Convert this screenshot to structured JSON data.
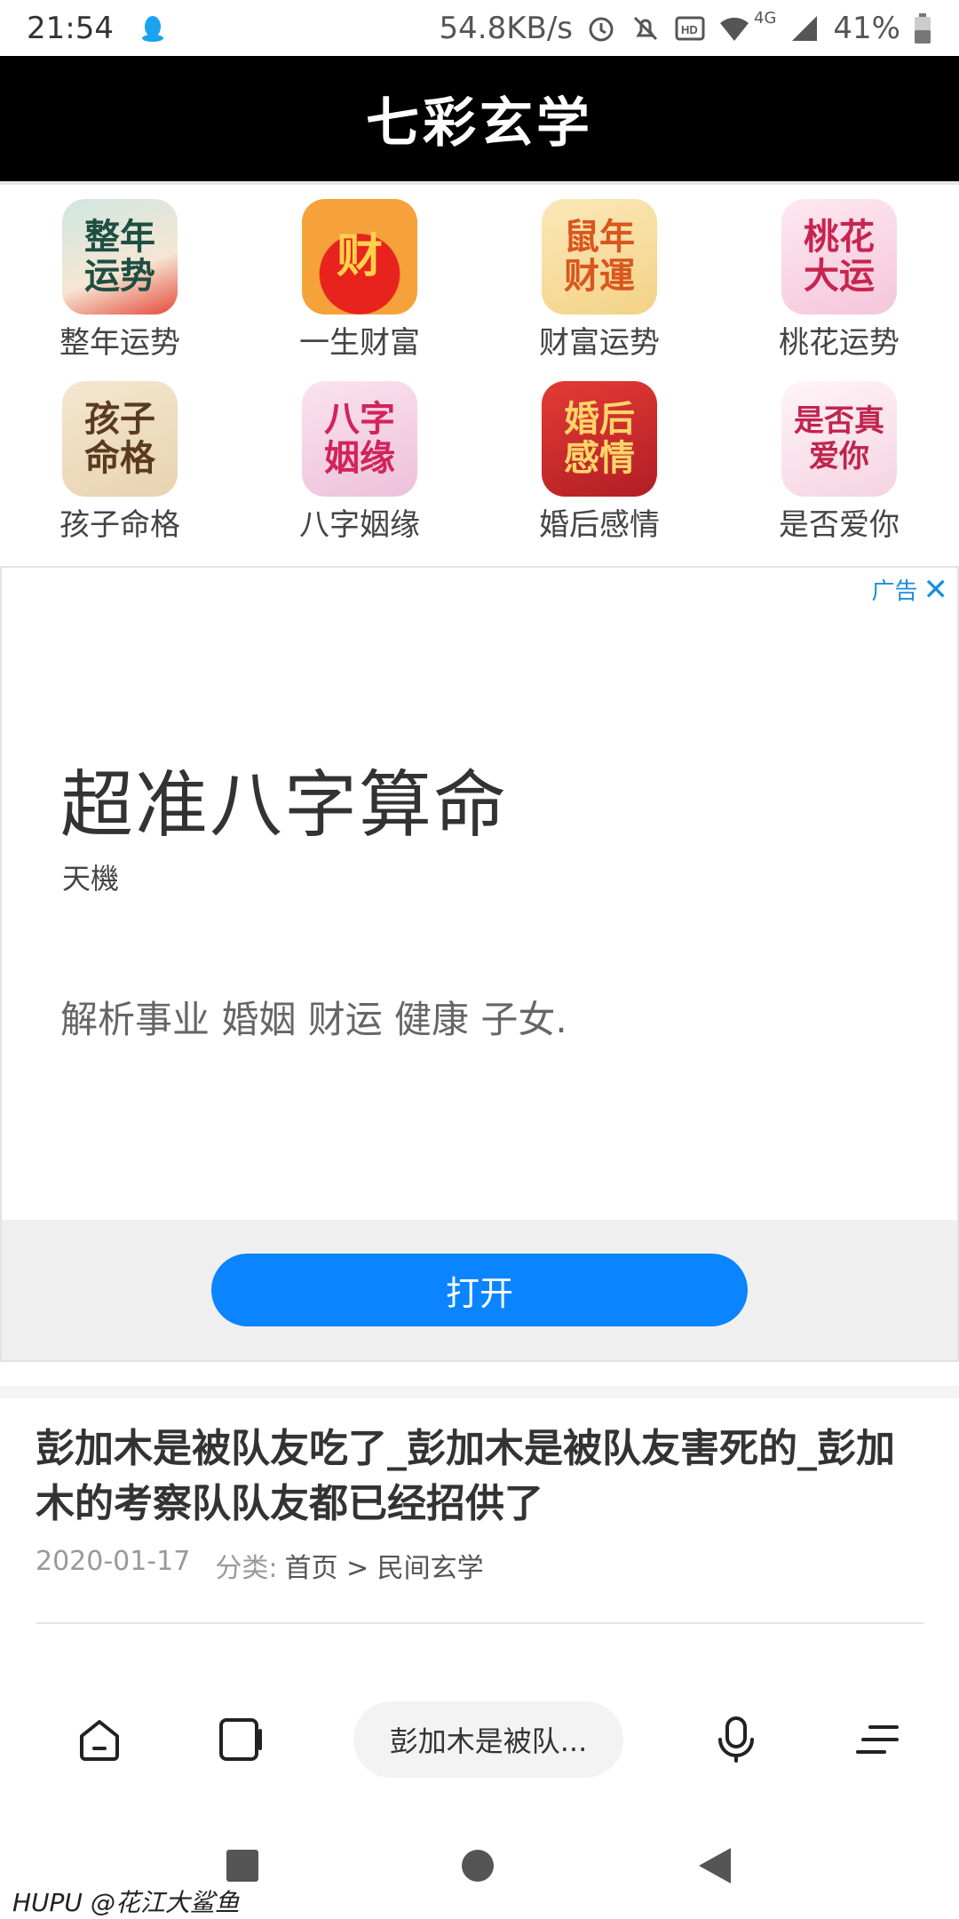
{
  "status_bar": {
    "time": "21:54",
    "net_speed": "54.8KB/s",
    "network_type": "4G",
    "battery": "41%"
  },
  "header": {
    "title": "七彩玄学"
  },
  "grid": {
    "items": [
      {
        "label": "整年运势",
        "icon_text": "整年运势"
      },
      {
        "label": "一生财富",
        "icon_text": "财"
      },
      {
        "label": "财富运势",
        "icon_text": "鼠年财運"
      },
      {
        "label": "桃花运势",
        "icon_text": "桃花大运"
      },
      {
        "label": "孩子命格",
        "icon_text": "孩子命格"
      },
      {
        "label": "八字姻缘",
        "icon_text": "八字姻缘"
      },
      {
        "label": "婚后感情",
        "icon_text": "婚后感情"
      },
      {
        "label": "是否爱你",
        "icon_text": "是否真爱你"
      }
    ]
  },
  "ad": {
    "badge": "广告",
    "title": "超准八字算命",
    "brand": "天機",
    "description": "解析事业 婚姻 财运 健康 子女.",
    "open_label": "打开"
  },
  "article": {
    "title": "彭加木是被队友吃了_彭加木是被队友害死的_彭加木的考察队队友都已经招供了",
    "date": "2020-01-17",
    "category_prefix": "分类:",
    "breadcrumb": "首页 > 民间玄学"
  },
  "toolbar": {
    "current_page": "彭加木是被队..."
  },
  "watermark": "HUPU @花江大鲨鱼",
  "colors": {
    "accent": "#0a84ff",
    "header_bg": "#000000",
    "ad_badge": "#1a8fd8"
  }
}
